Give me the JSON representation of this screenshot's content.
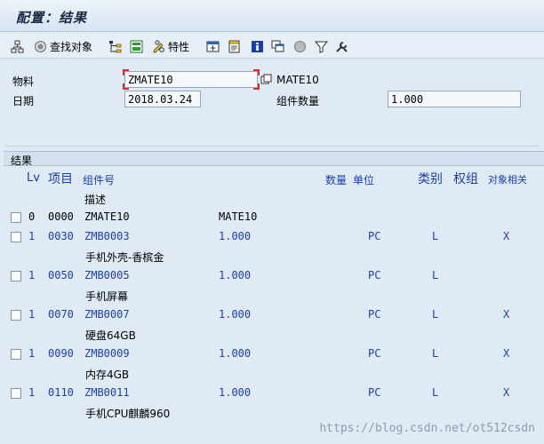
{
  "title": "配置：结果",
  "toolbar": {
    "find_object_label": "查找对象",
    "properties_label": "特性"
  },
  "form": {
    "material_label": "物料",
    "material_value": "ZMATE10",
    "material_desc": "MATE10",
    "date_label": "日期",
    "date_value": "2018.03.24",
    "qty_label": "组件数量",
    "qty_value": "1.000"
  },
  "results": {
    "section_label": "结果",
    "headers": {
      "lv": "Lv",
      "item": "项目",
      "component": "组件号",
      "description": "描述",
      "quantity": "数量",
      "unit": "单位",
      "category": "类别",
      "weight": "权组",
      "object_related": "对象相关"
    },
    "rows": [
      {
        "lv": "0",
        "item": "0000",
        "component": "ZMATE10",
        "qty": "MATE10",
        "unit": "",
        "cat": "",
        "obj": "",
        "desc": ""
      },
      {
        "lv": "1",
        "item": "0030",
        "component": "ZMB0003",
        "qty": "1.000",
        "unit": "PC",
        "cat": "L",
        "obj": "X",
        "desc": "手机外壳-香槟金"
      },
      {
        "lv": "1",
        "item": "0050",
        "component": "ZMB0005",
        "qty": "1.000",
        "unit": "PC",
        "cat": "L",
        "obj": "",
        "desc": "手机屏幕"
      },
      {
        "lv": "1",
        "item": "0070",
        "component": "ZMB0007",
        "qty": "1.000",
        "unit": "PC",
        "cat": "L",
        "obj": "X",
        "desc": "硬盘64GB"
      },
      {
        "lv": "1",
        "item": "0090",
        "component": "ZMB0009",
        "qty": "1.000",
        "unit": "PC",
        "cat": "L",
        "obj": "X",
        "desc": "内存4GB"
      },
      {
        "lv": "1",
        "item": "0110",
        "component": "ZMB0011",
        "qty": "1.000",
        "unit": "PC",
        "cat": "L",
        "obj": "X",
        "desc": "手机CPU麒麟960"
      }
    ]
  },
  "watermark": "https://blog.csdn.net/ot512csdn",
  "colors": {
    "background": "#dfeaf5",
    "link_blue": "#1a3fa8"
  }
}
